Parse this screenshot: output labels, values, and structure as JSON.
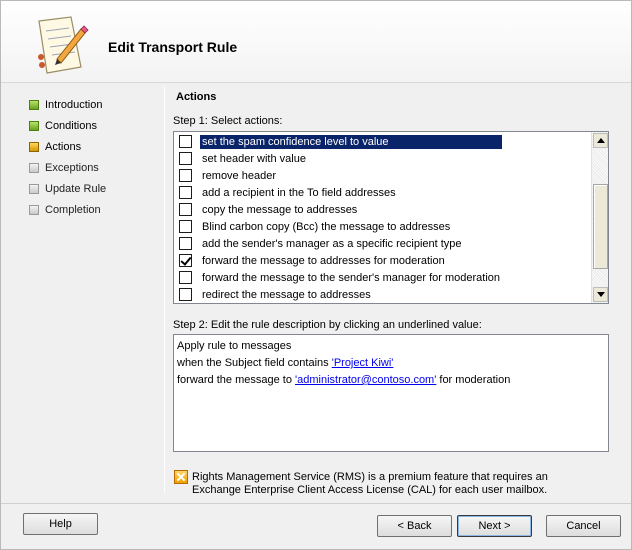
{
  "window": {
    "title": "Edit Transport Rule"
  },
  "nav": {
    "items": [
      {
        "label": "Introduction",
        "state": "done"
      },
      {
        "label": "Conditions",
        "state": "done"
      },
      {
        "label": "Actions",
        "state": "current"
      },
      {
        "label": "Exceptions",
        "state": "pending"
      },
      {
        "label": "Update Rule",
        "state": "pending"
      },
      {
        "label": "Completion",
        "state": "pending"
      }
    ]
  },
  "main": {
    "heading": "Actions",
    "step1_label": "Step 1: Select actions:",
    "actions": [
      {
        "label": "set the spam confidence level to value",
        "checked": false,
        "selected": true
      },
      {
        "label": "set header with value",
        "checked": false,
        "selected": false
      },
      {
        "label": "remove header",
        "checked": false,
        "selected": false
      },
      {
        "label": "add a recipient in the To field addresses",
        "checked": false,
        "selected": false
      },
      {
        "label": "copy the message to addresses",
        "checked": false,
        "selected": false
      },
      {
        "label": "Blind carbon copy (Bcc) the message to addresses",
        "checked": false,
        "selected": false
      },
      {
        "label": "add the sender's manager as a specific recipient type",
        "checked": false,
        "selected": false
      },
      {
        "label": "forward the message to addresses for moderation",
        "checked": true,
        "selected": false
      },
      {
        "label": "forward the message to the sender's manager for moderation",
        "checked": false,
        "selected": false
      },
      {
        "label": "redirect the message to addresses",
        "checked": false,
        "selected": false
      }
    ],
    "step2_label": "Step 2: Edit the rule description by clicking an underlined value:",
    "description": {
      "line1": "Apply rule to messages",
      "line2_prefix": "when the Subject field contains ",
      "line2_link": "'Project Kiwi'",
      "line3_prefix": "forward the message to ",
      "line3_link": "'administrator@contoso.com'",
      "line3_suffix": " for moderation"
    },
    "info_text": "Rights Management Service (RMS) is a premium feature that requires an Exchange Enterprise Client Access License (CAL) for each user mailbox."
  },
  "buttons": {
    "help": "Help",
    "back": "< Back",
    "next": "Next >",
    "cancel": "Cancel"
  }
}
